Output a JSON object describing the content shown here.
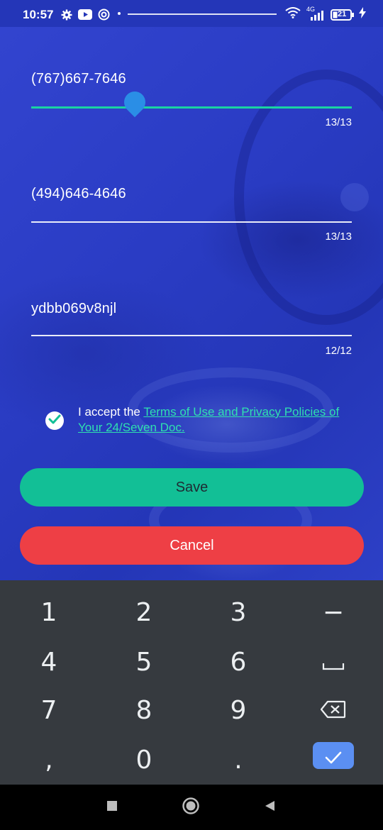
{
  "status_bar": {
    "time": "10:57",
    "network": "4G",
    "battery": "21",
    "icons": [
      "settings-icon",
      "youtube-icon",
      "notification-icon",
      "wifi-icon",
      "signal-icon",
      "battery-icon",
      "charging-icon"
    ]
  },
  "form": {
    "fields": [
      {
        "value": "(767)667-7646",
        "counter": "13/13",
        "active": true
      },
      {
        "value": "(494)646-4646",
        "counter": "13/13",
        "active": false
      },
      {
        "value": "ydbb069v8njl",
        "counter": "12/12",
        "active": false
      }
    ],
    "terms": {
      "checked": true,
      "prefix": "I accept the ",
      "link_text": "Terms of Use and Privacy Policies of Your 24/Seven Doc."
    },
    "save_label": "Save",
    "cancel_label": "Cancel"
  },
  "keyboard": {
    "rows": [
      [
        "1",
        "2",
        "3",
        "−"
      ],
      [
        "4",
        "5",
        "6",
        "space-icon"
      ],
      [
        "7",
        "8",
        "9",
        "backspace-icon"
      ],
      [
        ",",
        "0",
        ".",
        "enter-icon"
      ]
    ],
    "keys": {
      "k1": "1",
      "k2": "2",
      "k3": "3",
      "minus": "−",
      "k4": "4",
      "k5": "5",
      "k6": "6",
      "k7": "7",
      "k8": "8",
      "k9": "9",
      "comma": ",",
      "k0": "0",
      "period": "."
    }
  },
  "colors": {
    "accent_green": "#12bf96",
    "link_green": "#2fe0b0",
    "cancel_red": "#ee3f45",
    "background_blue": "#2c40c8",
    "keyboard_bg": "#363a3f",
    "enter_key_blue": "#5b8ff2"
  },
  "nav_bar": {
    "icons": [
      "recents-square-icon",
      "home-circle-icon",
      "back-triangle-icon"
    ]
  }
}
